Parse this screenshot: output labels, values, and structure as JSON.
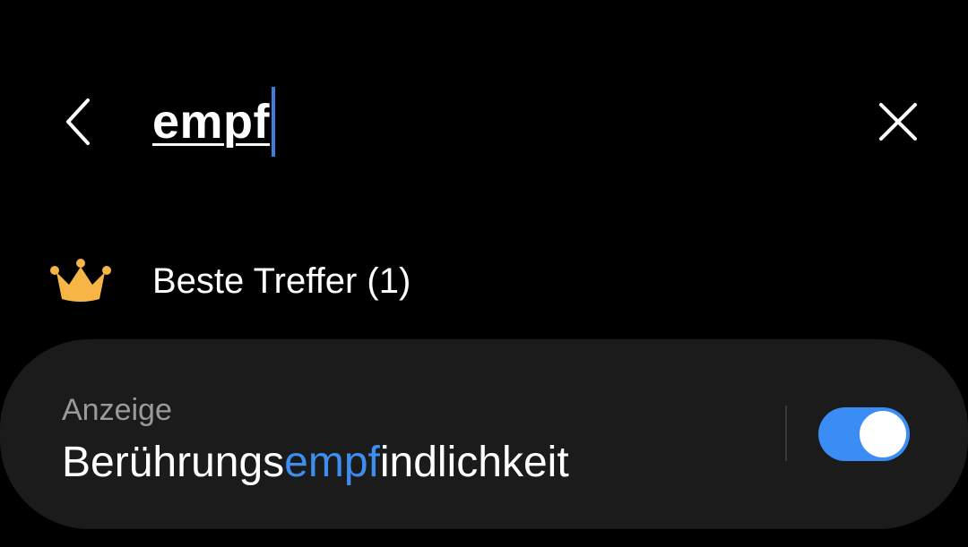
{
  "search": {
    "query": "empf"
  },
  "section": {
    "title": "Beste Treffer (1)",
    "icon": "crown-icon",
    "icon_color": "#f6b544"
  },
  "result": {
    "category": "Anzeige",
    "title_prefix": "Berührungs",
    "title_match": "empf",
    "title_suffix": "indlichkeit",
    "toggle_on": true,
    "highlight_color": "#3d8ef0",
    "toggle_color": "#3a8df4"
  }
}
